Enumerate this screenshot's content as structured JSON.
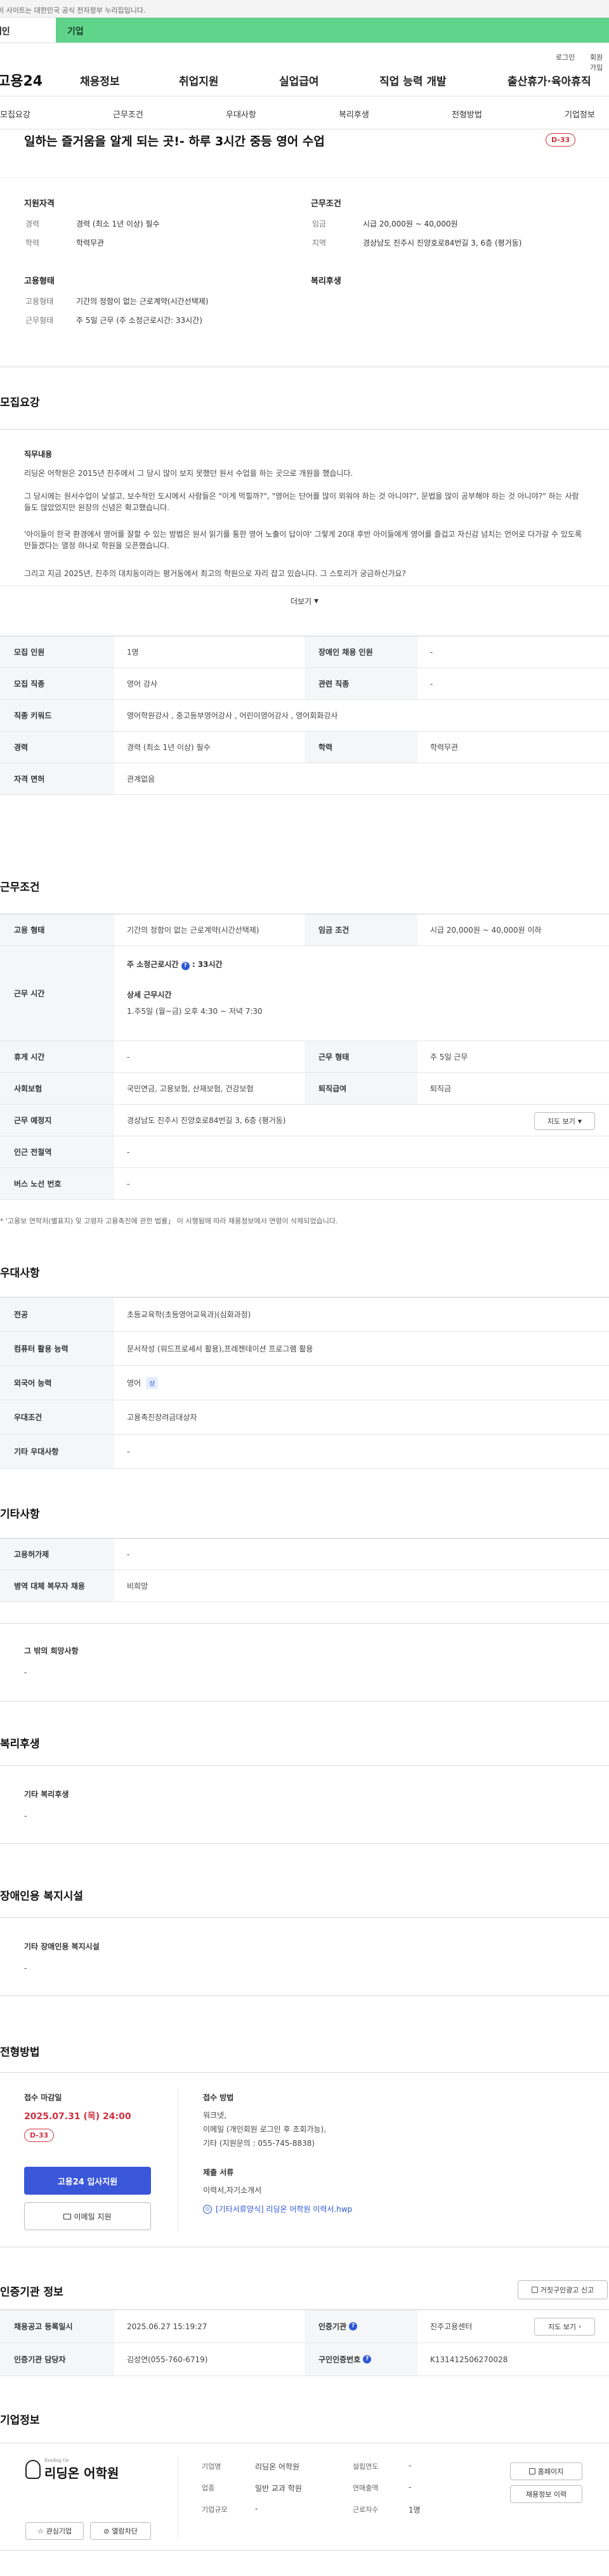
{
  "notice": "이 사이트는 대한민국 공식 전자정부 누리집입니다.",
  "top_tabs": {
    "person": "개인",
    "corp": "기업"
  },
  "util": {
    "login": "로그인",
    "join": "회원가입"
  },
  "gnb": {
    "logo": "고용24",
    "menu": [
      "채용정보",
      "취업지원",
      "실업급여",
      "직업 능력 개발",
      "출산휴가·육아휴직"
    ]
  },
  "subnav": [
    "모집요강",
    "근무조건",
    "우대사항",
    "복리후생",
    "전형방법",
    "기업정보"
  ],
  "hero": {
    "title": "일하는 즐거움을 알게 되는 곳!- 하루 3시간 중등 영어 수업",
    "dday": "D-33"
  },
  "summary": {
    "qual_title": "지원자격",
    "qual": [
      {
        "k": "경력",
        "v": "경력 (최소 1년 이상) 필수"
      },
      {
        "k": "학력",
        "v": "학력무관"
      }
    ],
    "cond_title": "근무조건",
    "cond": [
      {
        "k": "임금",
        "v": "시급 20,000원 ~ 40,000원"
      },
      {
        "k": "지역",
        "v": "경상남도 진주시 진양호로84번길 3, 6층 (평거동)"
      }
    ],
    "emp_title": "고용형태",
    "emp": [
      {
        "k": "고용형태",
        "v": "기간의 정함이 없는 근로계약(시간선택제)"
      },
      {
        "k": "근무형태",
        "v": "주 5일 근무 (주 소정근로시간: 33시간)"
      }
    ],
    "welfare_title": "복리후생"
  },
  "recruit": {
    "section_title": "모집요강",
    "duty_title": "직무내용",
    "duty_lines": [
      "리딩온 어학원은 2015년 진주에서 그 당시 많이 보지 못했던 원서 수업을 하는 곳으로 개원을 했습니다.",
      "그 당시에는 원서수업이 낯설고, 보수적인 도시에서 사람들은 \"이게 먹힐까?\", \"영어는 단어를 많이 외워야 하는 것 아니야?\", 문법을 많이 공부해야 하는 것 아니야?\" 하는 사람들도 많았었지만 원장의 신념은 확고했습니다.",
      "'아이들이 한국 환경에서 영어를 잘할 수 있는 방법은 원서 읽기를 통한 영어 노출이 답이야' 그렇게 20대 후반 아이들에게 영어를 즐겁고 자신감 넘치는 언어로 다가갈 수 있도록 만들겠다는 열정 하나로 학원을 오픈했습니다.",
      "그리고 지금 2025년, 진주의 대치동이라는 평거동에서 최고의 학원으로 자리 잡고 있습니다. 그 스토리가 궁금하신가요?"
    ],
    "more": "더보기",
    "table": [
      {
        "k": "모집 인원",
        "v": "1명",
        "k2": "장애인 채용 인원",
        "v2": "-"
      },
      {
        "k": "모집 직종",
        "v": "영어 강사",
        "k2": "관련 직종",
        "v2": "-"
      },
      {
        "k": "직종 키워드",
        "v": "영어학원강사 , 중고등부영어강사 , 어린이영어강사 , 영어회화강사"
      },
      {
        "k": "경력",
        "v": "경력 (최소 1년 이상) 필수",
        "k2": "학력",
        "v2": "학력무관"
      },
      {
        "k": "자격 면허",
        "v": "관계없음"
      }
    ]
  },
  "work": {
    "section_title": "근무조건",
    "emp_k": "고용 형태",
    "emp_v": "기간의 정함이 없는 근로계약(시간선택제)",
    "wage_k": "임금 조건",
    "wage_v": "시급 20,000원 ~ 40,000원 이하",
    "time_k": "근무 시간",
    "time_sub1": "주 소정근로시간",
    "time_v1": ": 33시간",
    "time_sub2": "상세 근무시간",
    "time_v2": "1.주5일 (월~금) 오후 4:30 ~ 저녁 7:30",
    "rest_k": "휴게 시간",
    "rest_v": "-",
    "form_k": "근무 형태",
    "form_v": "주 5일 근무",
    "ins_k": "사회보험",
    "ins_v": "국민연금, 고용보험, 산재보험, 건강보험",
    "ret_k": "퇴직급여",
    "ret_v": "퇴직금",
    "place_k": "근무 예정지",
    "place_v": "경상남도 진주시 진양호로84번길 3, 6층 (평거동)",
    "map_btn": "지도 보기",
    "subway_k": "인근 전철역",
    "subway_v": "-",
    "bus_k": "버스 노선 번호",
    "bus_v": "-",
    "note": "'고용보 연락처(별표지) 및 고령자 고용촉진에 관한 법률」 이 시행됨에 따라 채용정보에서 연령이 삭제되었습니다."
  },
  "pref": {
    "section_title": "우대사항",
    "rows": [
      {
        "k": "전공",
        "v": "초등교육학(초등영어교육과)(심화과정)"
      },
      {
        "k": "컴퓨터 활용 능력",
        "v": "문서작성 (워드프로세서 활용),프레젠테이션 프로그램 활용"
      },
      {
        "k": "외국어 능력",
        "v": "영어",
        "badge": "상"
      },
      {
        "k": "우대조건",
        "v": "고용촉진장려금대상자"
      },
      {
        "k": "기타 우대사항",
        "v": "-"
      }
    ]
  },
  "etc": {
    "section_title": "기타사항",
    "rows": [
      {
        "k": "고용허가제",
        "v": "-"
      },
      {
        "k": "병역 대체 복무자 채용",
        "v": "비희망"
      }
    ],
    "box_title": "그 밖의 희망사항",
    "box_v": "-"
  },
  "welfare": {
    "section_title": "복리후생",
    "box_title": "기타 복리후생",
    "box_v": "-"
  },
  "disab": {
    "section_title": "장애인용 복지시설",
    "box_title": "기타 장애인용 복지시설",
    "box_v": "-"
  },
  "process": {
    "section_title": "전형방법",
    "deadline_title": "접수 마감일",
    "deadline": "2025.07.31 (목) 24:00",
    "dday": "D-33",
    "apply_btn": "고용24 입사지원",
    "email_btn": "이메일 지원",
    "method_title": "접수 방법",
    "methods": [
      "워크넷,",
      "이메일 (개인회원 로그인 후 조회가능),",
      "기타 (지원문의 : 055-745-8838)"
    ],
    "docs_title": "제출 서류",
    "docs": "이력서,자기소개서",
    "file": "[기타서류양식] 리딩온 어학원 이력서.hwp"
  },
  "agency": {
    "section_title": "인증기관 정보",
    "report_btn": "거짓구인광고 신고",
    "rows": [
      {
        "k": "채용공고 등록일시",
        "v": "2025.06.27 15:19:27",
        "k2": "인증기관",
        "v2": "진주고용센터",
        "btn": "지도 보기"
      },
      {
        "k": "인증기관 담당자",
        "v": "김성연(055-760-6719)",
        "k2": "구인인증번호",
        "v2": "K131412506270028"
      }
    ]
  },
  "company": {
    "section_title": "기업정보",
    "logo_text": "리딩온 어학원",
    "logo_sub": "Reading On",
    "name_k": "기업명",
    "name_v": "리딩온 어학원",
    "year_k": "설립연도",
    "year_v": "-",
    "ind_k": "업종",
    "ind_v": "일반 교과 학원",
    "sales_k": "연매출액",
    "sales_v": "-",
    "size_k": "기업규모",
    "size_v": "-",
    "emp_k": "근로자수",
    "emp_v": "1명",
    "home_btn": "홈페이지",
    "jobs_btn": "채용정보 이력",
    "fav_btn": "관심기업",
    "block_btn": "열람차단"
  }
}
